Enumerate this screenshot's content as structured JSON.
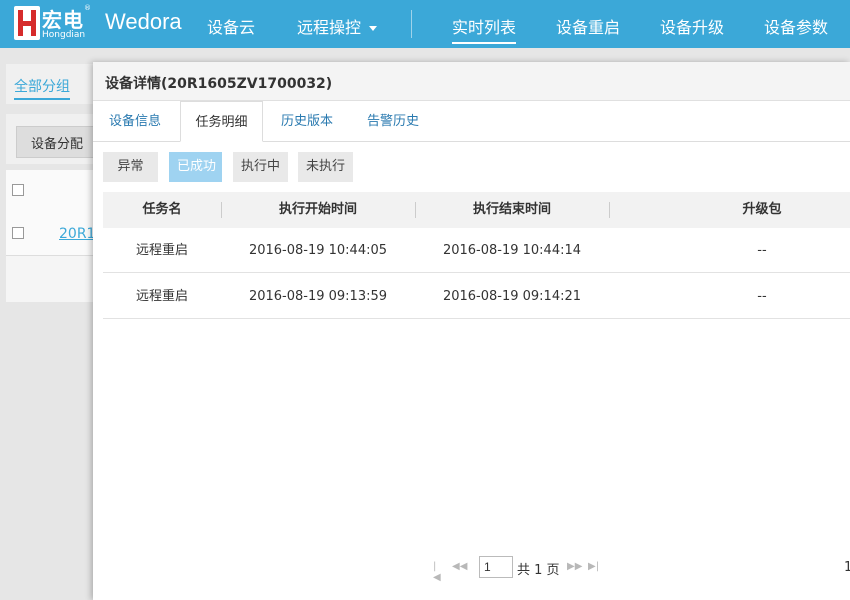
{
  "topbar": {
    "logo_cn": "宏电",
    "logo_en": "Hongdian",
    "logo_reg": "®",
    "brand": "Wedora",
    "nav": [
      "设备云",
      "远程操控",
      "实时列表",
      "设备重启",
      "设备升级",
      "设备参数"
    ],
    "accent": "#3ba8d8"
  },
  "background": {
    "group_tab": "全部分组",
    "assign_button": "设备分配",
    "row_link": "20R1"
  },
  "modal": {
    "title": "设备详情(20R1605ZV1700032)",
    "tabs": [
      "设备信息",
      "任务明细",
      "历史版本",
      "告警历史"
    ],
    "active_tab": "任务明细",
    "filters": [
      "异常",
      "已成功",
      "执行中",
      "未执行"
    ],
    "active_filter": "已成功",
    "columns": [
      "任务名",
      "执行开始时间",
      "执行结束时间",
      "升级包"
    ],
    "rows": [
      [
        "远程重启",
        "2016-08-19 10:44:05",
        "2016-08-19 10:44:14",
        "--"
      ],
      [
        "远程重启",
        "2016-08-19 09:13:59",
        "2016-08-19 09:14:21",
        "--"
      ]
    ],
    "pager": {
      "page": "1",
      "total_text": "共 1 页",
      "right_text": "1"
    }
  }
}
